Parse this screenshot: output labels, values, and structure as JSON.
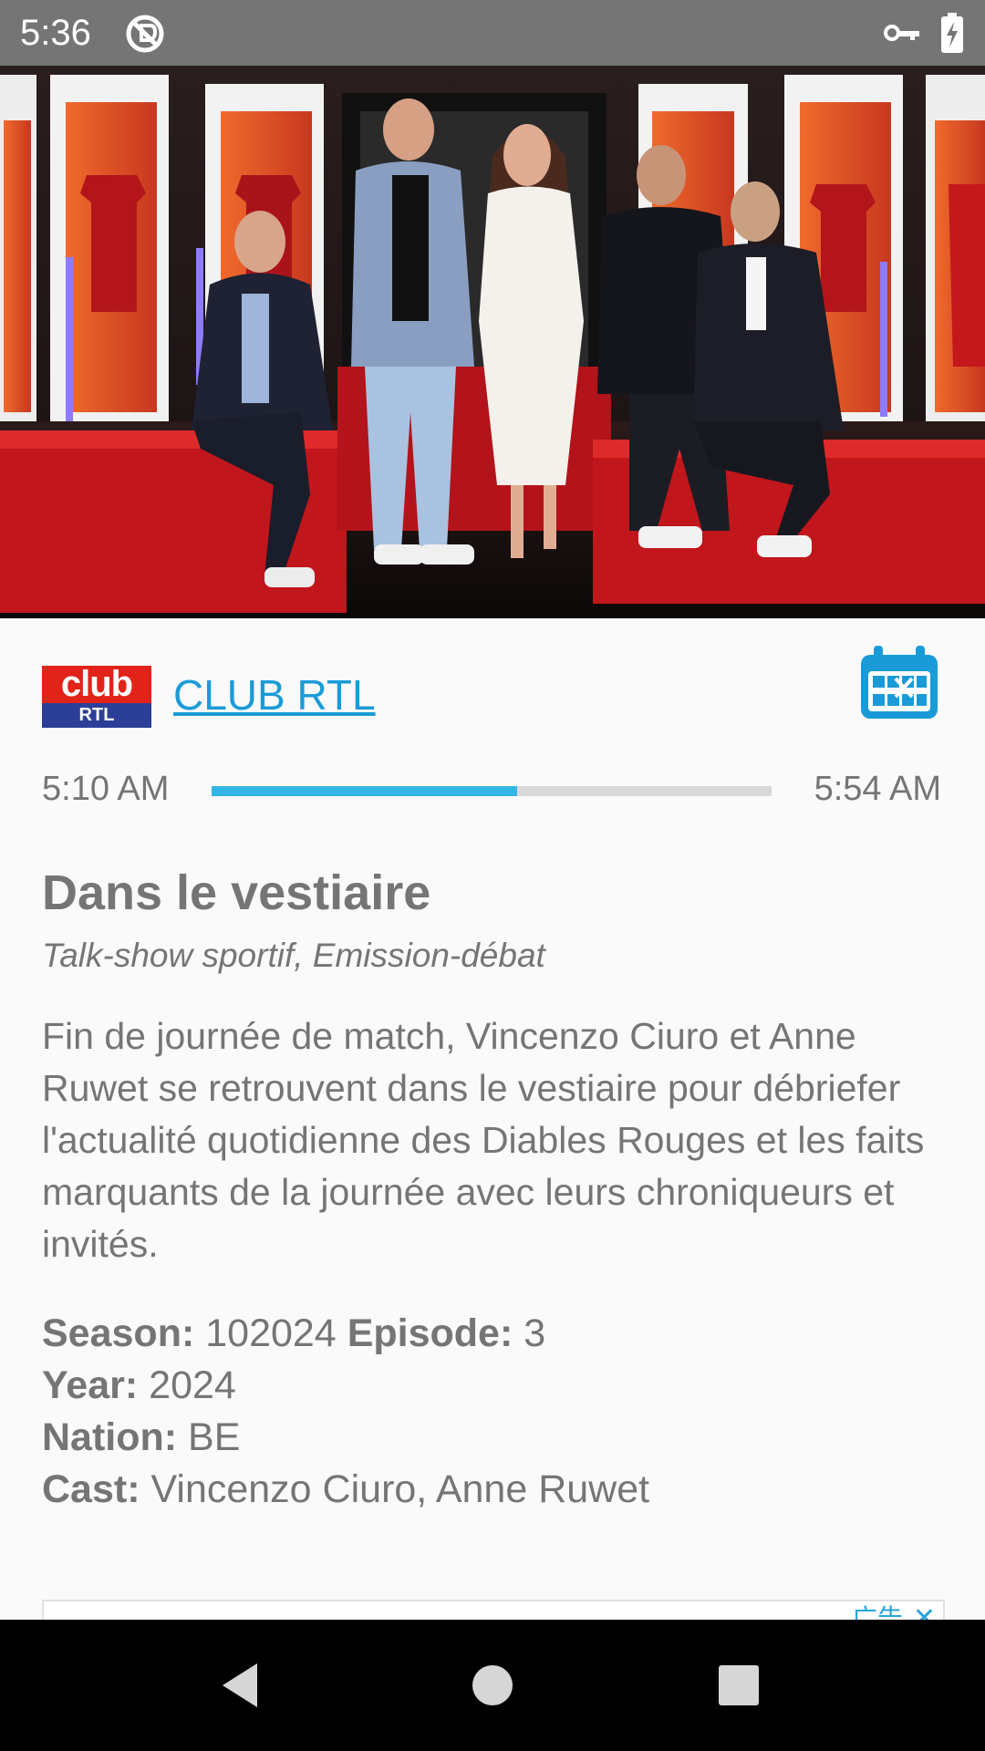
{
  "status_bar": {
    "time": "5:36",
    "icons": [
      "do-not-disturb-icon",
      "vpn-key-icon",
      "battery-charging-icon"
    ]
  },
  "hero": {
    "image": "studio-presenters-photo"
  },
  "channel": {
    "logo_top": "club",
    "logo_bottom": "RTL",
    "name": "CLUB RTL",
    "icon": "calendar-cancel-icon"
  },
  "schedule": {
    "start": "5:10 AM",
    "end": "5:54 AM",
    "progress_percent": 54.5
  },
  "program": {
    "title": "Dans le vestiaire",
    "genre": "Talk-show sportif, Emission-débat",
    "description": "Fin de journée de match, Vincenzo Ciuro et Anne Ruwet se retrouvent dans le vestiaire pour débriefer l'actualité quotidienne des Diables Rouges et les faits marquants de la journée avec leurs chroniqueurs et invités."
  },
  "details": {
    "season_label": "Season:",
    "season": "102024",
    "episode_label": "Episode:",
    "episode": "3",
    "year_label": "Year:",
    "year": "2024",
    "nation_label": "Nation:",
    "nation": "BE",
    "cast_label": "Cast:",
    "cast": "Vincenzo Ciuro, Anne Ruwet"
  },
  "ad": {
    "label": "广告",
    "close": "✕"
  },
  "colors": {
    "status_bar": "#757575",
    "accent": "#33b5e5",
    "link": "#1a9bd7",
    "text": "#757575",
    "logo_red": "#e2231a",
    "logo_blue": "#2c3f98"
  }
}
